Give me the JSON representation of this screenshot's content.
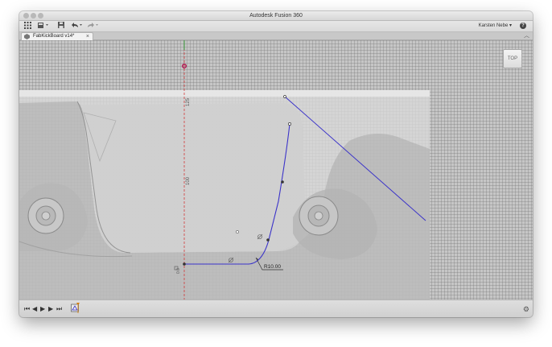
{
  "window": {
    "title": "Autodesk Fusion 360"
  },
  "toolbar": {
    "user": "Karsten Nebe ▾",
    "help_icon": "?"
  },
  "document": {
    "tab_title": "FabKickBoard v14*",
    "close_glyph": "×"
  },
  "viewcube": {
    "face_label": "TOP"
  },
  "sketch": {
    "fillet_dimension": "R10.00",
    "axis_label_top": "125",
    "axis_label_mid": "100",
    "axis_label_bottom": "0.0"
  },
  "colors": {
    "sketch_line": "#3a32c9",
    "axis_red": "#d23b3b",
    "point_magenta": "#b0114f"
  }
}
